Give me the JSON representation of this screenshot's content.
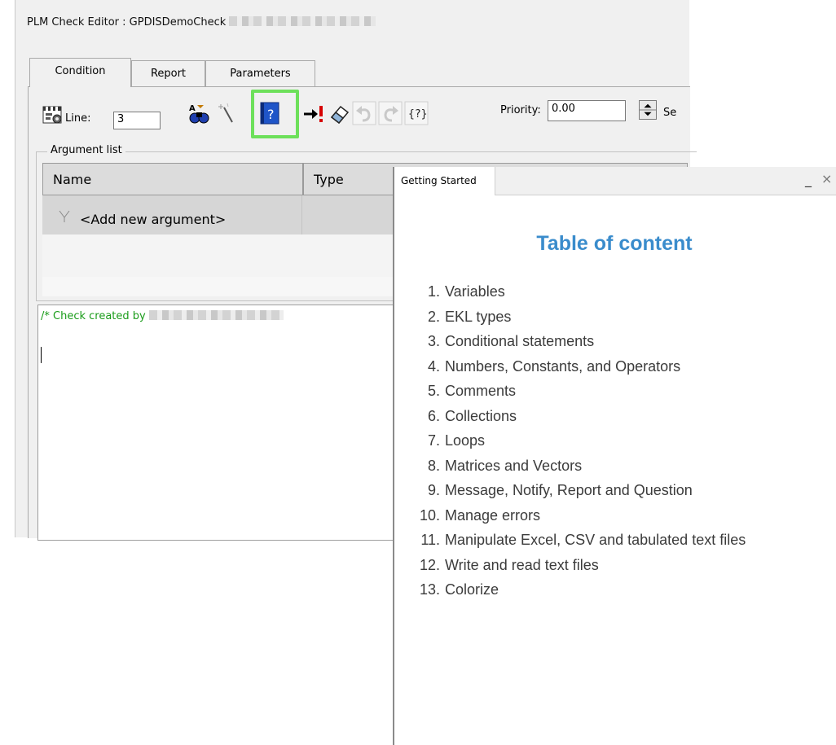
{
  "editor": {
    "title": "PLM Check Editor : GPDISDemoCheck",
    "tabs": [
      {
        "label": "Condition"
      },
      {
        "label": "Report"
      },
      {
        "label": "Parameters"
      }
    ],
    "toolbar": {
      "line_label": "Line:",
      "line_value": "3",
      "priority_label": "Priority:",
      "priority_value": "0.00",
      "severity_label_partial": "Se"
    },
    "argument_list": {
      "legend": "Argument list",
      "columns": [
        "Name",
        "Type"
      ],
      "add_row_label": "<Add new argument>"
    },
    "code": {
      "line1": "/* Check created by"
    },
    "highlight_color": "#6de05a"
  },
  "getting_started": {
    "tab_label": "Getting Started",
    "minimize": "_",
    "close": "×",
    "heading": "Table of content",
    "heading_color": "#3a8ccc",
    "items": [
      {
        "num": "1.",
        "label": "Variables"
      },
      {
        "num": "2.",
        "label": "EKL types"
      },
      {
        "num": "3.",
        "label": "Conditional statements"
      },
      {
        "num": "4.",
        "label": "Numbers, Constants, and Operators"
      },
      {
        "num": "5.",
        "label": "Comments"
      },
      {
        "num": "6.",
        "label": "Collections"
      },
      {
        "num": "7.",
        "label": "Loops"
      },
      {
        "num": "8.",
        "label": "Matrices and Vectors"
      },
      {
        "num": "9.",
        "label": "Message, Notify, Report and Question"
      },
      {
        "num": "10.",
        "label": "Manage errors"
      },
      {
        "num": "11.",
        "label": "Manipulate Excel, CSV and tabulated text files"
      },
      {
        "num": "12.",
        "label": "Write and read text files"
      },
      {
        "num": "13.",
        "label": "Colorize"
      }
    ]
  }
}
